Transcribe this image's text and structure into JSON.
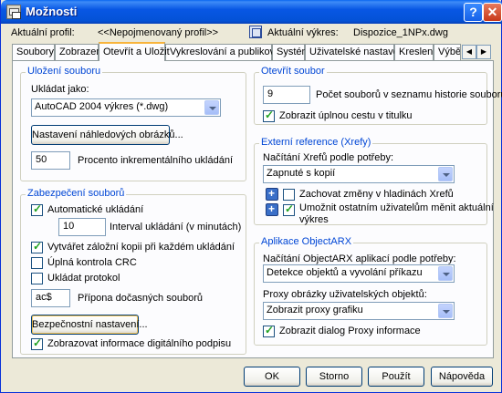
{
  "window": {
    "title": "Možnosti"
  },
  "profile": {
    "current_label": "Aktuální profil:",
    "current_value": "<<Nepojmenovaný profil>>",
    "drawing_label": "Aktuální výkres:",
    "drawing_value": "Dispozice_1NPx.dwg"
  },
  "tabs": [
    {
      "label": "Soubory"
    },
    {
      "label": "Zobrazení"
    },
    {
      "label": "Otevřít a Uložit"
    },
    {
      "label": "Vykreslování a publikování"
    },
    {
      "label": "Systém"
    },
    {
      "label": "Uživatelské nastavení"
    },
    {
      "label": "Kreslení"
    },
    {
      "label": "Výběr"
    }
  ],
  "save": {
    "group_title": "Uložení souboru",
    "save_as_label": "Ukládat jako:",
    "save_as_value": "AutoCAD 2004 výkres (*.dwg)",
    "thumbnail_button": "Nastavení náhledových obrázků...",
    "incremental_value": "50",
    "incremental_label": "Procento inkrementálního ukládání"
  },
  "safety": {
    "group_title": "Zabezpečení souborů",
    "autosave_label": "Automatické ukládání",
    "autosave_checked": true,
    "interval_value": "10",
    "interval_label": "Interval ukládání (v minutách)",
    "backup_label": "Vytvářet záložní kopii při každém ukládání",
    "backup_checked": true,
    "crc_label": "Úplná kontrola CRC",
    "crc_checked": false,
    "log_label": "Ukládat protokol",
    "log_checked": false,
    "temp_ext_value": "ac$",
    "temp_ext_label": "Přípona dočasných souborů",
    "security_button": "Bezpečnostní nastavení...",
    "digital_sig_label": "Zobrazovat informace digitálního podpisu",
    "digital_sig_checked": true
  },
  "open": {
    "group_title": "Otevřít soubor",
    "history_value": "9",
    "history_label": "Počet souborů v seznamu historie souborů",
    "full_path_label": "Zobrazit úplnou cestu v titulku",
    "full_path_checked": true
  },
  "xref": {
    "group_title": "Externí reference (Xrefy)",
    "load_label": "Načítání Xrefů podle potřeby:",
    "load_value": "Zapnuté s kopií",
    "layer_changes_label": "Zachovat změny v hladinách Xrefů",
    "layer_changes_checked": false,
    "allow_edit_label_1": "Umožnit ostatním uživatelům měnit aktuální",
    "allow_edit_label_2": "výkres",
    "allow_edit_checked": true
  },
  "objectarx": {
    "group_title": "Aplikace ObjectARX",
    "load_label": "Načítání ObjectARX aplikací podle potřeby:",
    "load_value": "Detekce objektů a vyvolání příkazu",
    "proxy_label": "Proxy obrázky uživatelských objektů:",
    "proxy_value": "Zobrazit proxy grafiku",
    "proxy_dialog_label": "Zobrazit dialog Proxy informace",
    "proxy_dialog_checked": true
  },
  "buttons": {
    "ok": "OK",
    "cancel": "Storno",
    "apply": "Použít",
    "help": "Nápověda"
  }
}
